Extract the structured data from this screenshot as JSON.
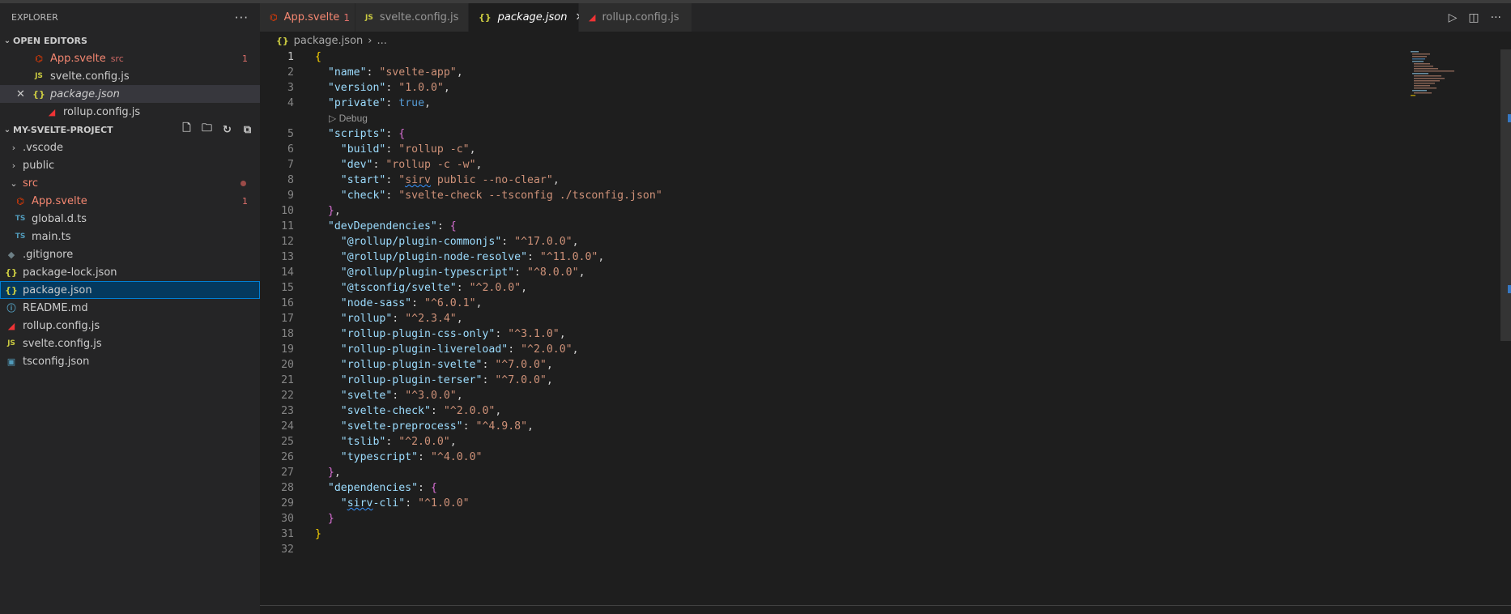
{
  "sidebar": {
    "title": "EXPLORER",
    "more": "···",
    "open_editors": {
      "header": "OPEN EDITORS",
      "items": [
        {
          "icon": "svelte-icon",
          "glyph": "⌬",
          "label": "App.svelte",
          "desc": "src",
          "badge": "1"
        },
        {
          "icon": "js-icon",
          "glyph": "JS",
          "label": "svelte.config.js"
        },
        {
          "icon": "json-icon",
          "glyph": "{}",
          "label": "package.json",
          "close": "✕"
        },
        {
          "icon": "rollup-icon",
          "glyph": "◢",
          "label": "rollup.config.js"
        }
      ]
    },
    "project": {
      "header": "MY-SVELTE-PROJECT",
      "tree": [
        {
          "type": "folder",
          "label": ".vscode",
          "chev": "›"
        },
        {
          "type": "folder",
          "label": "public",
          "chev": "›"
        },
        {
          "type": "folder",
          "label": "src",
          "chev": "⌄"
        },
        {
          "type": "file",
          "icon": "svelte-icon",
          "glyph": "⌬",
          "label": "App.svelte",
          "badge": "1"
        },
        {
          "type": "file",
          "icon": "ts-icon",
          "glyph": "TS",
          "label": "global.d.ts"
        },
        {
          "type": "file",
          "icon": "ts-icon",
          "glyph": "TS",
          "label": "main.ts"
        },
        {
          "type": "file",
          "icon": "git-icon",
          "glyph": "◆",
          "label": ".gitignore"
        },
        {
          "type": "file",
          "icon": "json-icon",
          "glyph": "{}",
          "label": "package-lock.json"
        },
        {
          "type": "file",
          "icon": "json-icon",
          "glyph": "{}",
          "label": "package.json"
        },
        {
          "type": "file",
          "icon": "info-icon",
          "glyph": "ⓘ",
          "label": "README.md"
        },
        {
          "type": "file",
          "icon": "rollup-icon",
          "glyph": "◢",
          "label": "rollup.config.js"
        },
        {
          "type": "file",
          "icon": "js-icon",
          "glyph": "JS",
          "label": "svelte.config.js"
        },
        {
          "type": "file",
          "icon": "tsconfig-icon",
          "glyph": "▣",
          "label": "tsconfig.json"
        }
      ]
    }
  },
  "tabs": [
    {
      "glyph": "⌬",
      "label": "App.svelte",
      "badge": "1"
    },
    {
      "glyph": "JS",
      "label": "svelte.config.js"
    },
    {
      "glyph": "{}",
      "label": "package.json",
      "close": "✕"
    },
    {
      "glyph": "◢",
      "label": "rollup.config.js"
    }
  ],
  "breadcrumb": {
    "glyph": "{}",
    "file": "package.json",
    "sep": "›",
    "more": "..."
  },
  "codelens": "▷ Debug",
  "line_numbers": [
    "1",
    "2",
    "3",
    "4",
    "5",
    "6",
    "7",
    "8",
    "9",
    "10",
    "11",
    "12",
    "13",
    "14",
    "15",
    "16",
    "17",
    "18",
    "19",
    "20",
    "21",
    "22",
    "23",
    "24",
    "25",
    "26",
    "27",
    "28",
    "29",
    "30",
    "31",
    "32"
  ],
  "code": {
    "l1": "{",
    "name_k": "\"name\"",
    "name_v": "\"svelte-app\"",
    "version_k": "\"version\"",
    "version_v": "\"1.0.0\"",
    "private_k": "\"private\"",
    "private_v": "true",
    "scripts_k": "\"scripts\"",
    "build_k": "\"build\"",
    "build_v": "\"rollup -c\"",
    "dev_k": "\"dev\"",
    "dev_v": "\"rollup -c -w\"",
    "start_k": "\"start\"",
    "start_q": "\"",
    "start_sirv": "sirv",
    "start_rest": " public --no-clear\"",
    "check_k": "\"check\"",
    "check_v": "\"svelte-check --tsconfig ./tsconfig.json\"",
    "devdeps_k": "\"devDependencies\"",
    "dd": [
      {
        "k": "\"@rollup/plugin-commonjs\"",
        "v": "\"^17.0.0\""
      },
      {
        "k": "\"@rollup/plugin-node-resolve\"",
        "v": "\"^11.0.0\""
      },
      {
        "k": "\"@rollup/plugin-typescript\"",
        "v": "\"^8.0.0\""
      },
      {
        "k": "\"@tsconfig/svelte\"",
        "v": "\"^2.0.0\""
      },
      {
        "k": "\"node-sass\"",
        "v": "\"^6.0.1\""
      },
      {
        "k": "\"rollup\"",
        "v": "\"^2.3.4\""
      },
      {
        "k": "\"rollup-plugin-css-only\"",
        "v": "\"^3.1.0\""
      },
      {
        "k": "\"rollup-plugin-livereload\"",
        "v": "\"^2.0.0\""
      },
      {
        "k": "\"rollup-plugin-svelte\"",
        "v": "\"^7.0.0\""
      },
      {
        "k": "\"rollup-plugin-terser\"",
        "v": "\"^7.0.0\""
      },
      {
        "k": "\"svelte\"",
        "v": "\"^3.0.0\""
      },
      {
        "k": "\"svelte-check\"",
        "v": "\"^2.0.0\""
      },
      {
        "k": "\"svelte-preprocess\"",
        "v": "\"^4.9.8\""
      },
      {
        "k": "\"tslib\"",
        "v": "\"^2.0.0\""
      },
      {
        "k": "\"typescript\"",
        "v": "\"^4.0.0\""
      }
    ],
    "deps_k": "\"dependencies\"",
    "sirv_q": "\"",
    "sirv_sirv": "sirv",
    "sirv_rest": "-cli\"",
    "sirv_v": "\"^1.0.0\""
  }
}
